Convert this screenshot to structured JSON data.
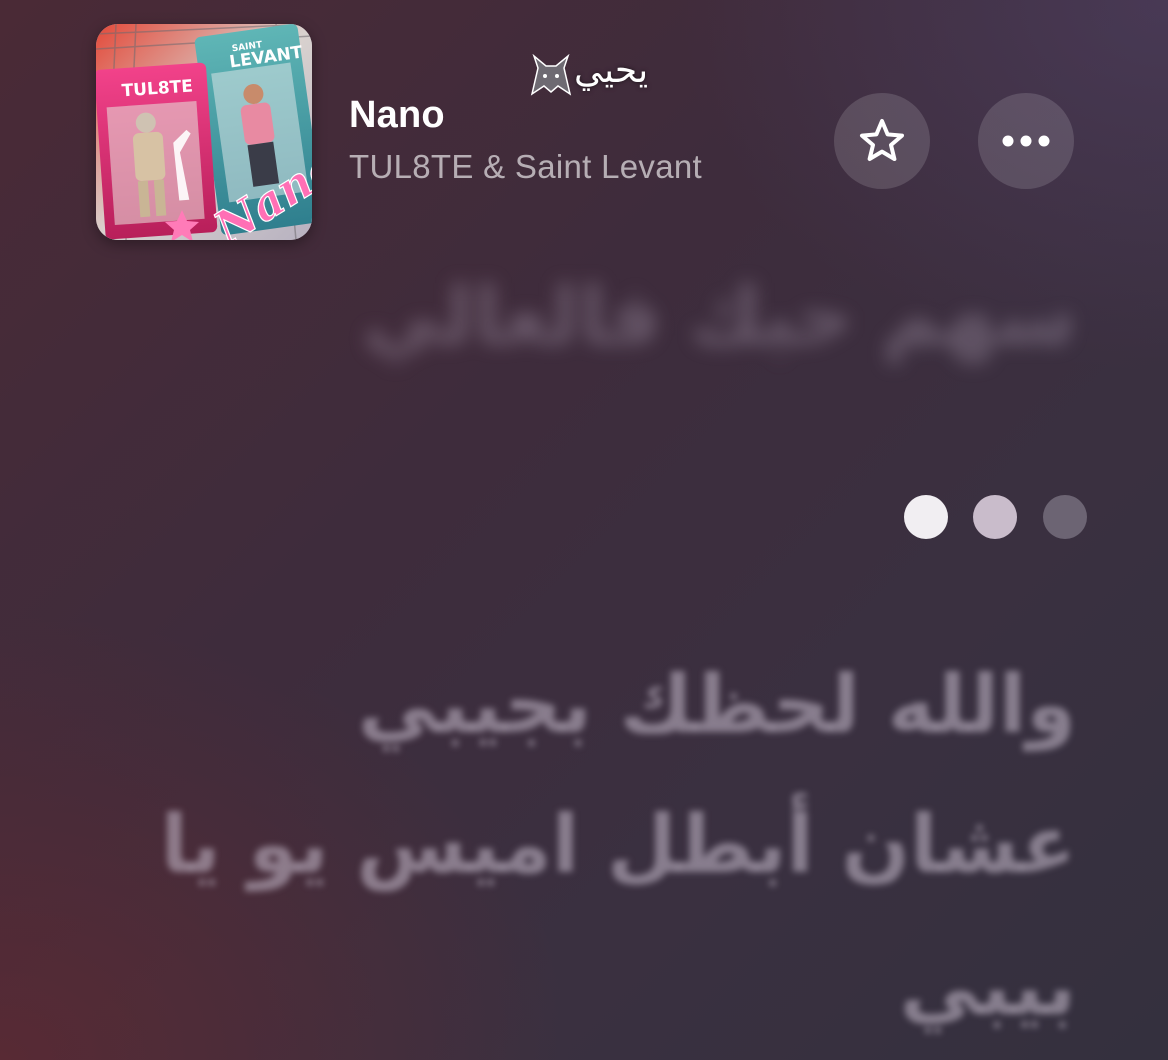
{
  "now_playing": {
    "title": "Nano",
    "artist": "TUL8TE & Saint Levant",
    "artwork": {
      "label_left": "TUL8TE",
      "label_right_top": "SAINT",
      "label_right": "LEVANT",
      "script_text": "Nano"
    },
    "watermark_text": "يحيي",
    "watermark_icon": "wolf-icon"
  },
  "actions": {
    "favorite_icon": "star-icon",
    "more_icon": "ellipsis-icon"
  },
  "lyrics": {
    "previous_line": "سهم حبك فالعالي",
    "lines": [
      "والله لحظك بجيبي",
      "عشان أبطل اميس يو يا",
      "بيبي"
    ]
  },
  "interlude_dots": {
    "count": 3,
    "active_index": 0,
    "colors": [
      "#f1eef2",
      "#c9bccb",
      "#8a8592"
    ]
  }
}
